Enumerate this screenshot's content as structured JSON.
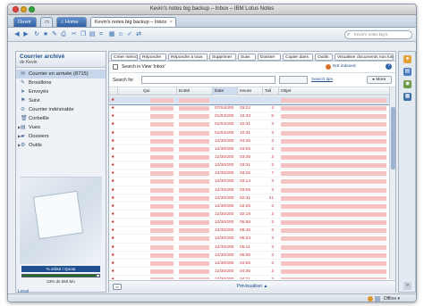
{
  "window": {
    "title": "Kevin's notes big backup – Inbox – IBM Lotus Notes"
  },
  "tabs": [
    {
      "label": "Ouvrir"
    },
    {
      "label": ""
    },
    {
      "label": "Home"
    },
    {
      "label": "Kevin's notes big backup – Inbox"
    }
  ],
  "toolbar": {
    "search_placeholder": "Kevin's notes big b"
  },
  "sidebar": {
    "title": "Courrier archivé",
    "subtitle": "de Kevin",
    "items": [
      {
        "label": "Courrier en arrivée (8715)",
        "icon": "inbox-icon"
      },
      {
        "label": "Brouillons",
        "icon": "drafts-icon"
      },
      {
        "label": "Envoyés",
        "icon": "sent-icon"
      },
      {
        "label": "Suivi",
        "icon": "follow-up-icon"
      },
      {
        "label": "Courrier indésirable",
        "icon": "junk-icon"
      },
      {
        "label": "Corbeille",
        "icon": "trash-icon"
      },
      {
        "label": "Vues",
        "icon": "views-icon"
      },
      {
        "label": "Dossiers",
        "icon": "folders-icon"
      },
      {
        "label": "Outils",
        "icon": "tools-icon"
      }
    ],
    "quota_label": "% utilisé / Quota",
    "quota_fraction": 0.96,
    "quota_text": "23% de 550 Mo",
    "location": "Local"
  },
  "actions": [
    "Créer mémo",
    "Répondre",
    "Répondre à tous",
    "Supprimer",
    "Suivi",
    "Dossier",
    "Copier dans",
    "Outils",
    "Visualiser documents non lus"
  ],
  "search": {
    "in_view_label": "Search in View 'Inbox'",
    "not_indexed": "Not indexed",
    "for_label": "Search for",
    "tips": "Search tips",
    "more": "More"
  },
  "columns": [
    "Qui",
    "Entité",
    "Date",
    "Heure",
    "Tail",
    "Objet"
  ],
  "rows": [
    {
      "date": "",
      "time": "",
      "size": ""
    },
    {
      "date": "07/04/200",
      "time": "03:22",
      "size": "3"
    },
    {
      "date": "01/04/200",
      "time": "10:33",
      "size": "8"
    },
    {
      "date": "01/04/200",
      "time": "10:31",
      "size": "3"
    },
    {
      "date": "01/04/200",
      "time": "10:31",
      "size": "3"
    },
    {
      "date": "12/30/200",
      "time": "04:25",
      "size": "3"
    },
    {
      "date": "12/30/200",
      "time": "04:05",
      "size": "3"
    },
    {
      "date": "12/30/200",
      "time": "03:35",
      "size": "3"
    },
    {
      "date": "12/30/200",
      "time": "03:31",
      "size": "3"
    },
    {
      "date": "12/30/200",
      "time": "03:25",
      "size": "7"
    },
    {
      "date": "12/30/200",
      "time": "03:14",
      "size": "3"
    },
    {
      "date": "12/30/200",
      "time": "03:05",
      "size": "3"
    },
    {
      "date": "12/30/200",
      "time": "02:31",
      "size": "31"
    },
    {
      "date": "12/30/200",
      "time": "02:25",
      "size": "3"
    },
    {
      "date": "12/30/200",
      "time": "02:18",
      "size": "3"
    },
    {
      "date": "12/30/200",
      "time": "06:59",
      "size": "3"
    },
    {
      "date": "12/30/200",
      "time": "06:45",
      "size": "3"
    },
    {
      "date": "12/30/200",
      "time": "05:23",
      "size": "3"
    },
    {
      "date": "12/30/200",
      "time": "05:11",
      "size": "3"
    },
    {
      "date": "12/30/200",
      "time": "05:05",
      "size": "3"
    },
    {
      "date": "12/30/200",
      "time": "04:55",
      "size": "3"
    },
    {
      "date": "12/30/200",
      "time": "04:35",
      "size": "3"
    },
    {
      "date": "12/30/200",
      "time": "04:31",
      "size": "3"
    }
  ],
  "footer": {
    "preview": "Prévisualiser ▲"
  },
  "status": {
    "offline": "Offline ▾"
  }
}
